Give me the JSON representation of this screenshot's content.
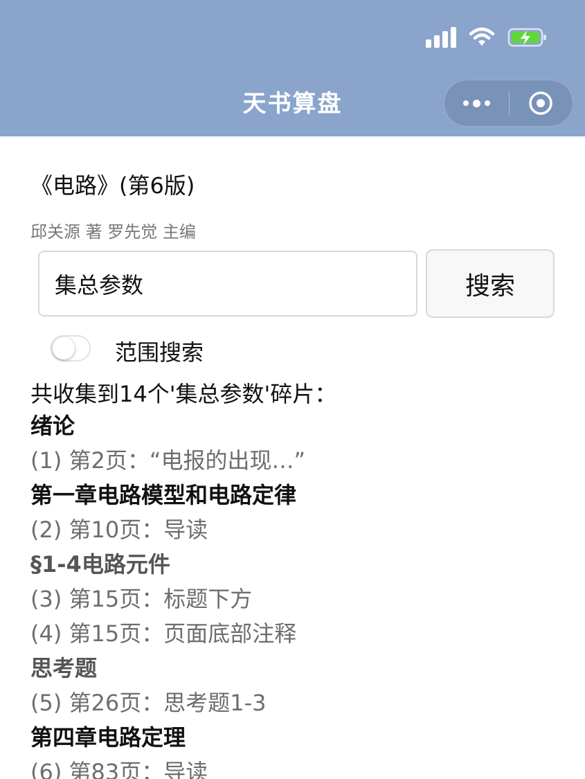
{
  "header": {
    "title": "天书算盘"
  },
  "book": {
    "title": "《电路》(第6版)",
    "authors": "邱关源 著 罗先觉 主编"
  },
  "search": {
    "value": "集总参数",
    "button_label": "搜索"
  },
  "range_toggle": {
    "label": "范围搜索",
    "on": false
  },
  "summary": "共收集到14个'集总参数'碎片：",
  "results": [
    {
      "kind": "chapter",
      "text": "绪论"
    },
    {
      "kind": "hit",
      "text": "(1) 第2页：“电报的出现…”"
    },
    {
      "kind": "chapter",
      "text": "第一章电路模型和电路定律"
    },
    {
      "kind": "hit",
      "text": "(2) 第10页：导读"
    },
    {
      "kind": "section",
      "text": "§1-4电路元件"
    },
    {
      "kind": "hit",
      "text": "(3) 第15页：标题下方"
    },
    {
      "kind": "hit",
      "text": "(4) 第15页：页面底部注释"
    },
    {
      "kind": "section",
      "text": "思考题"
    },
    {
      "kind": "hit",
      "text": "(5) 第26页：思考题1-3"
    },
    {
      "kind": "chapter",
      "text": "第四章电路定理"
    },
    {
      "kind": "hit",
      "text": "(6) 第83页：导读"
    }
  ],
  "colors": {
    "header_bg": "#8aa4cb",
    "text_primary": "#111111",
    "text_muted": "#6d6d6d"
  },
  "icons": {
    "signal": "cellular-signal-icon",
    "wifi": "wifi-icon",
    "battery": "battery-charging-icon",
    "more": "more-dots-icon",
    "close": "close-miniprogram-icon"
  }
}
